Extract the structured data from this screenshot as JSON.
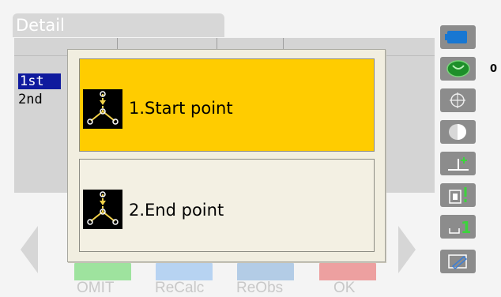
{
  "window": {
    "title": "Detail"
  },
  "table": {
    "rows": [
      {
        "label": "1st",
        "selected": true
      },
      {
        "label": "2nd",
        "selected": false
      }
    ]
  },
  "dialog": {
    "options": [
      {
        "label": "1.Start point",
        "highlighted": true,
        "icon": "survey-point-icon"
      },
      {
        "label": "2.End point",
        "highlighted": false,
        "icon": "survey-point-icon"
      }
    ]
  },
  "softkeys": [
    {
      "label": "OMIT",
      "color": "#6fd36f"
    },
    {
      "label": "ReCalc",
      "color": "#7fb0e6"
    },
    {
      "label": "ReObs",
      "color": "#7fa8d8"
    },
    {
      "label": "OK",
      "color": "#e06060"
    }
  ],
  "side_panel": {
    "battery_color": "#1877d2",
    "tilt_value": "0",
    "icons": [
      "battery-icon",
      "tilt-icon",
      "target-icon",
      "laser-icon",
      "offset-icon",
      "edm-icon",
      "input-mode-icon",
      "edit-icon"
    ]
  },
  "colors": {
    "highlight": "#ffcc00",
    "selection": "#0f1a9e",
    "side_button": "#8c8c8c"
  }
}
